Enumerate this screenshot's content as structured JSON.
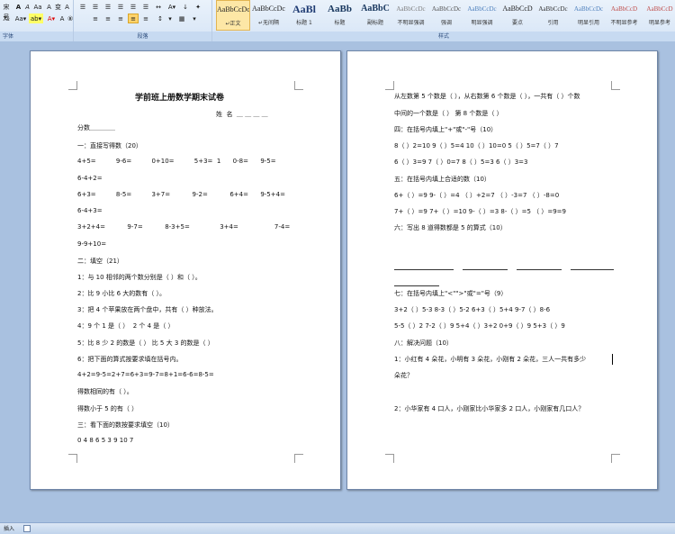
{
  "ribbon": {
    "font_group": {
      "label": "字体",
      "row1": [
        "宋号",
        "A",
        "A",
        "Aa",
        "A",
        "变",
        "A"
      ],
      "row2": [
        "X₂",
        "Aa▾",
        "ab▾",
        "A▾",
        "A",
        "⑧"
      ]
    },
    "paragraph_group": {
      "label": "段落",
      "row1": [
        "☰",
        "☰",
        "☰",
        "☰",
        "☰",
        "☰",
        "↔",
        "A▾",
        "↓",
        "✦"
      ],
      "row2": [
        "≡",
        "≡",
        "≡",
        "≡",
        "≡",
        "↕",
        "▾",
        "▦",
        "▾"
      ]
    },
    "styles_group": {
      "label": "样式",
      "tiles": [
        {
          "preview": "AaBbCcDc",
          "name": "↵正文",
          "selected": true
        },
        {
          "preview": "AaBbCcDc",
          "name": "↵无间隔",
          "selected": false
        },
        {
          "preview": "AaBl",
          "name": "标题 1",
          "selected": false
        },
        {
          "preview": "AaBb",
          "name": "标题",
          "selected": false
        },
        {
          "preview": "AaBbC",
          "name": "副标题",
          "selected": false
        },
        {
          "preview": "AaBbCcDc",
          "name": "不明显强调",
          "selected": false
        },
        {
          "preview": "AaBbCcDc",
          "name": "强调",
          "selected": false
        },
        {
          "preview": "AaBbCcDc",
          "name": "明显强调",
          "selected": false
        },
        {
          "preview": "AaBbCcD",
          "name": "要点",
          "selected": false
        },
        {
          "preview": "AaBbCcDc",
          "name": "引用",
          "selected": false
        },
        {
          "preview": "AaBbCcDc",
          "name": "明显引用",
          "selected": false
        },
        {
          "preview": "AaBbCcD",
          "name": "不明显参考",
          "selected": false
        },
        {
          "preview": "AaBbCcD",
          "name": "明显参考",
          "selected": false
        }
      ]
    }
  },
  "page1": {
    "title": "学前班上册数学期末试卷",
    "name_line": "姓  名  ＿ ＿ ＿ ＿",
    "lines": [
      "分数＿＿＿＿",
      "一：直接写得数（20）",
      "4+5=          9-6=          0+10=          5+3=  1      0-8=      9-5=",
      "6-4+2=",
      "6+3=          8-5=          3+7=           9-2=           6+4=      9-5+4=",
      "6-4+3=",
      "3+2+4=           9-7=           8-3+5=               3+4=                  7-4=",
      "9-9+10=",
      "二：填空（21）",
      "1：与 10 相邻的两个数分别是（ ）和（ ）。",
      "2：比 9 小比 6 大的数有（ ）。",
      "3：把 4 个苹果放在两个盘中，共有（ ）种放法。",
      "4：9 个 1 是（ ）  2 个 4 是（ ）",
      "5：比 8 少 2 的数是（ ） 比 5 大 3 的数是（ ）",
      "6：把下面的算式按要求填在括号内。",
      "4+2=9-5=2+7=6+3=9-7=8+1=6-6=8-5=",
      "得数相同的有（ ）。",
      "得数小于 5 的有（ ）",
      "三：看下面的数按要求填空（10）",
      "0 4 8 6 5 3 9 10 7"
    ]
  },
  "page2": {
    "lines": [
      "从左数第 5 个数是（ ），从右数第 6 个数是（ ），一共有（ ）个数",
      "中间的一个数是（ ） 第 8 个数是（ ）",
      "四：在括号内填上\"+\"或\"-\"号（10）",
      "8（ ）2=10 9（ ）5=4 10（ ）10=0 5（ ）5=7（ ）7",
      "6（ ）3=9 7（ ）0=7 8（ ）5=3 6（ ）3=3",
      "五：在括号内填上合适的数（10）",
      "6+（ ）=9 9-（ ）=4 （ ）+2=7 （ ）-3=7 （ ）-8=0",
      "7+（ ）=9 7+（ ）=10 9-（ ）=3 8-（ ）=5 （ ）=9=9",
      "六：写出 8 道得数都是 5 的算式（10）",
      "七：在括号内填上\"<\"\">\"或\"=\"号（9）",
      "3+2（ ）5-3 8-3（ ）5-2 6+3（ ）5+4 9-7（ ）8-6",
      "5-5（ ）2 7-2（ ）9 5+4（ ）3+2 0+9（ ）9 5+3（ ）9",
      "八：解决问题（10）",
      "1：小红有 4 朵花，小明有 3 朵花，小刚有 2 朵花，三人一共有多少",
      "朵花？",
      "2：小华家有 4 口人，小刚家比小华家多 2 口人，小刚家有几口人？"
    ]
  },
  "statusbar": {
    "mode": "插入"
  }
}
